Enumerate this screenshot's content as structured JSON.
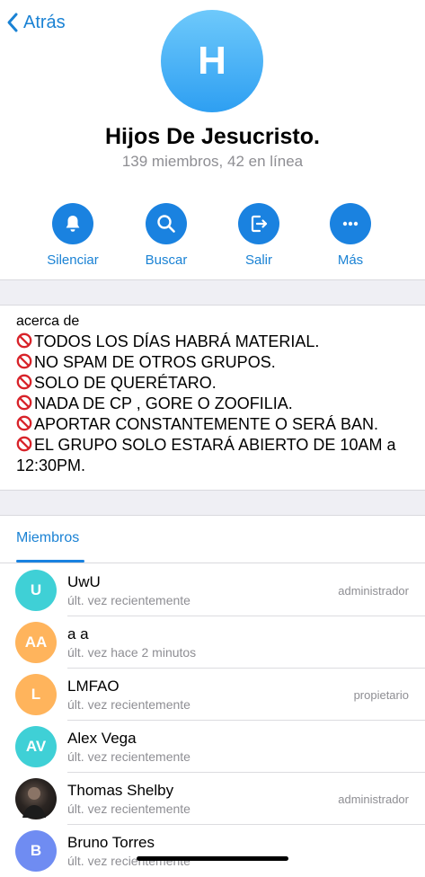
{
  "nav": {
    "back_label": "Atrás"
  },
  "group": {
    "avatar_letter": "H",
    "name": "Hijos De Jesucristo.",
    "subtitle": "139 miembros, 42 en línea"
  },
  "actions": [
    {
      "label": "Silenciar",
      "icon": "bell-icon"
    },
    {
      "label": "Buscar",
      "icon": "search-icon"
    },
    {
      "label": "Salir",
      "icon": "exit-icon"
    },
    {
      "label": "Más",
      "icon": "more-icon"
    }
  ],
  "about": {
    "label": "acerca de",
    "lines": [
      "TODOS LOS DÍAS HABRÁ MATERIAL.",
      "NO SPAM DE OTROS GRUPOS.",
      "SOLO DE QUERÉTARO.",
      "NADA DE CP , GORE O ZOOFILIA.",
      "APORTAR CONSTANTEMENTE O SERÁ BAN.",
      "EL GRUPO SOLO ESTARÁ ABIERTO DE 10AM a",
      "12:30PM."
    ]
  },
  "members_tab": {
    "label": "Miembros"
  },
  "members": [
    {
      "initials": "U",
      "name": "UwU",
      "status": "últ. vez recientemente",
      "role": "administrador",
      "color": "#3fd0d6"
    },
    {
      "initials": "AA",
      "name": "a a",
      "status": "últ. vez hace 2 minutos",
      "role": "",
      "color": "#ffb45c"
    },
    {
      "initials": "L",
      "name": "LMFAO",
      "status": "últ. vez recientemente",
      "role": "propietario",
      "color": "#ffb45c"
    },
    {
      "initials": "AV",
      "name": "Alex Vega",
      "status": "últ. vez recientemente",
      "role": "",
      "color": "#3fd0d6"
    },
    {
      "initials": "",
      "name": "Thomas Shelby",
      "status": "últ. vez recientemente",
      "role": "administrador",
      "color": "#2a2a2a"
    },
    {
      "initials": "B",
      "name": "Bruno Torres",
      "status": "últ. vez recientemente",
      "role": "",
      "color": "#6f8cf2"
    }
  ]
}
